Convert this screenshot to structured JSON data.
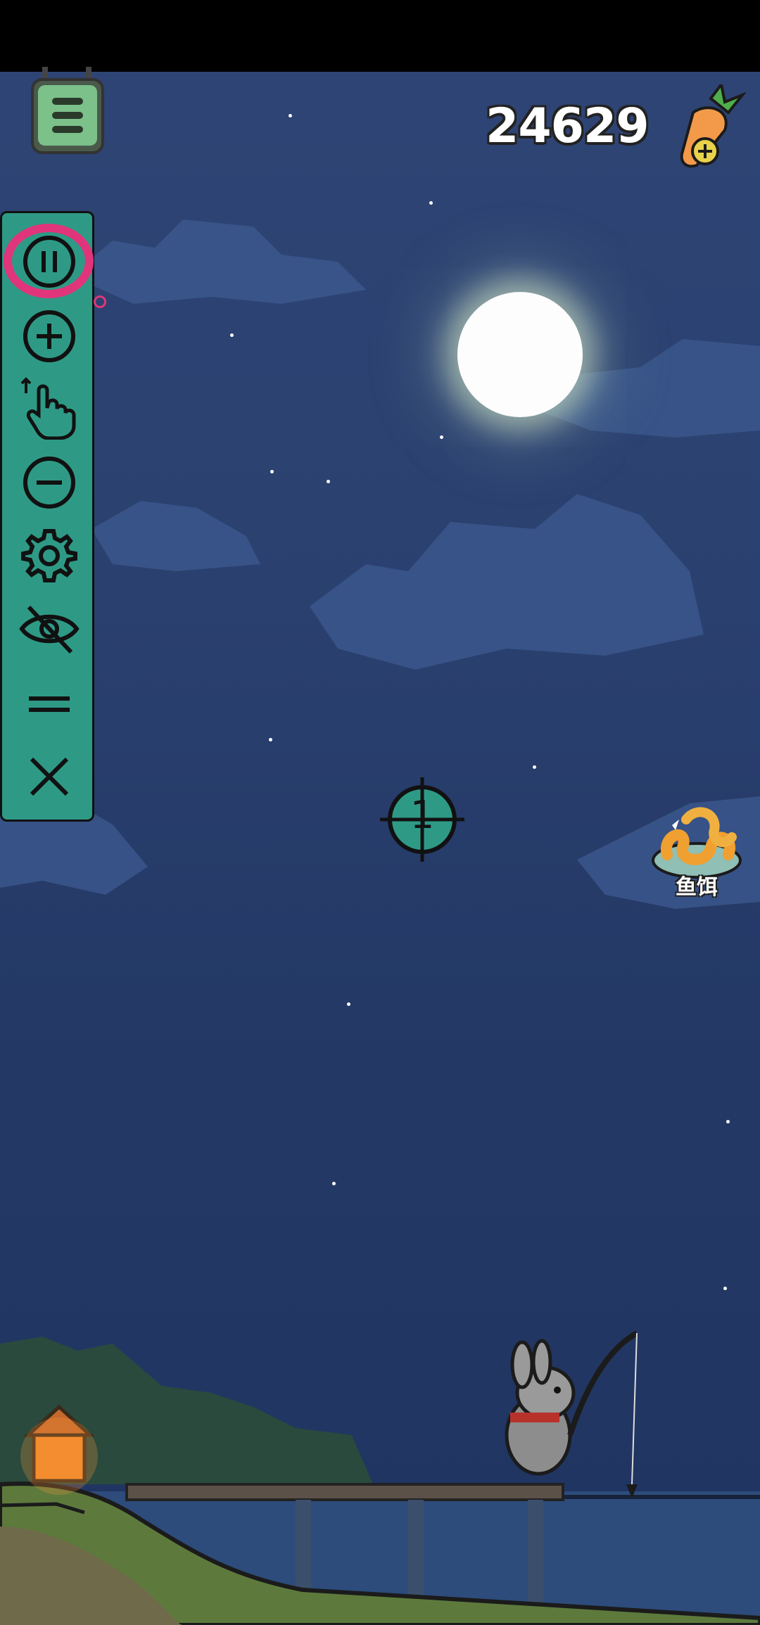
{
  "hud": {
    "score": "24629",
    "menu_icon": "menu-list-icon",
    "carrot_icon": "carrot-add-icon"
  },
  "toolbar": {
    "items": [
      {
        "name": "pause",
        "icon": "pause-icon"
      },
      {
        "name": "add",
        "icon": "plus-icon"
      },
      {
        "name": "gesture",
        "icon": "swipe-hand-icon"
      },
      {
        "name": "remove",
        "icon": "minus-icon"
      },
      {
        "name": "settings",
        "icon": "gear-icon"
      },
      {
        "name": "hide",
        "icon": "eye-off-icon"
      },
      {
        "name": "drag",
        "icon": "drag-handle-icon"
      },
      {
        "name": "close",
        "icon": "close-icon"
      }
    ]
  },
  "target": {
    "number": "1"
  },
  "bait": {
    "label": "鱼饵",
    "icon": "worm-bait-icon"
  },
  "colors": {
    "sky": "#2b4170",
    "toolbar": "#2e9a86",
    "highlight": "#e0357a",
    "moon": "#fdfdfd"
  }
}
